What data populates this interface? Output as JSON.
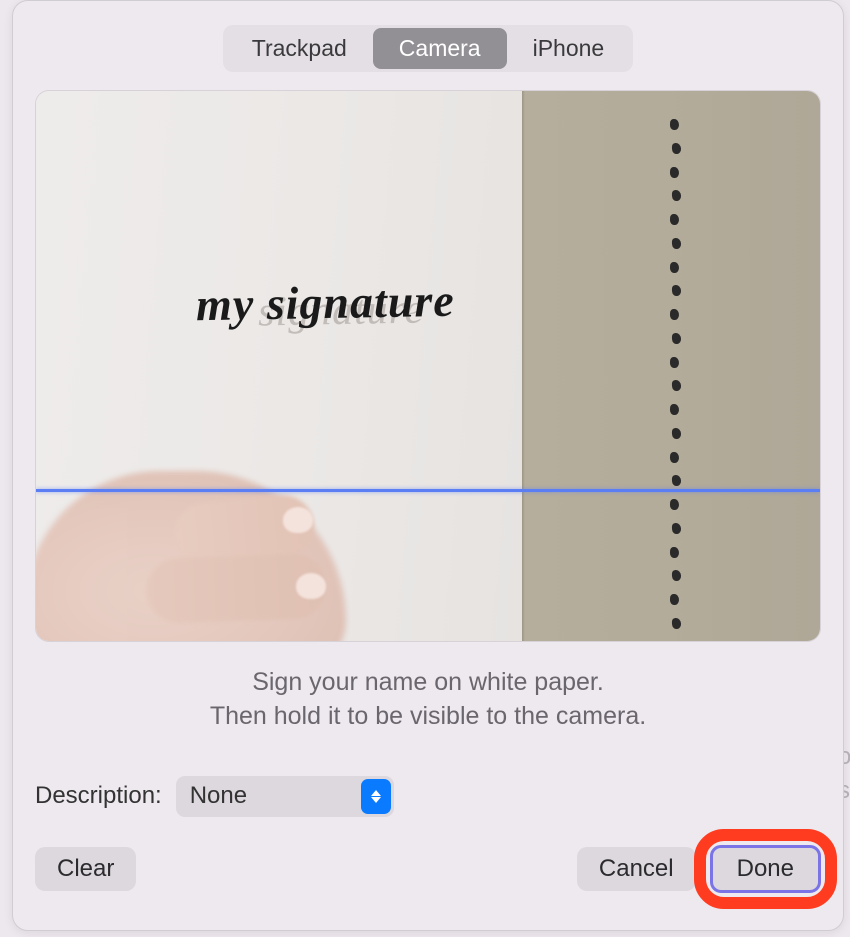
{
  "tabs": {
    "trackpad": "Trackpad",
    "camera": "Camera",
    "iphone": "iPhone",
    "active": "camera"
  },
  "preview": {
    "signature_text": "my signature"
  },
  "instructions": {
    "line1": "Sign your name on white paper.",
    "line2": "Then hold it to be visible to the camera."
  },
  "description": {
    "label": "Description:",
    "value": "None"
  },
  "buttons": {
    "clear": "Clear",
    "cancel": "Cancel",
    "done": "Done"
  },
  "colors": {
    "accent_blue": "#0a7aff",
    "scan_line": "#5b7ef5",
    "highlight_ring": "#ff3b20",
    "done_border": "#7a74e6"
  }
}
